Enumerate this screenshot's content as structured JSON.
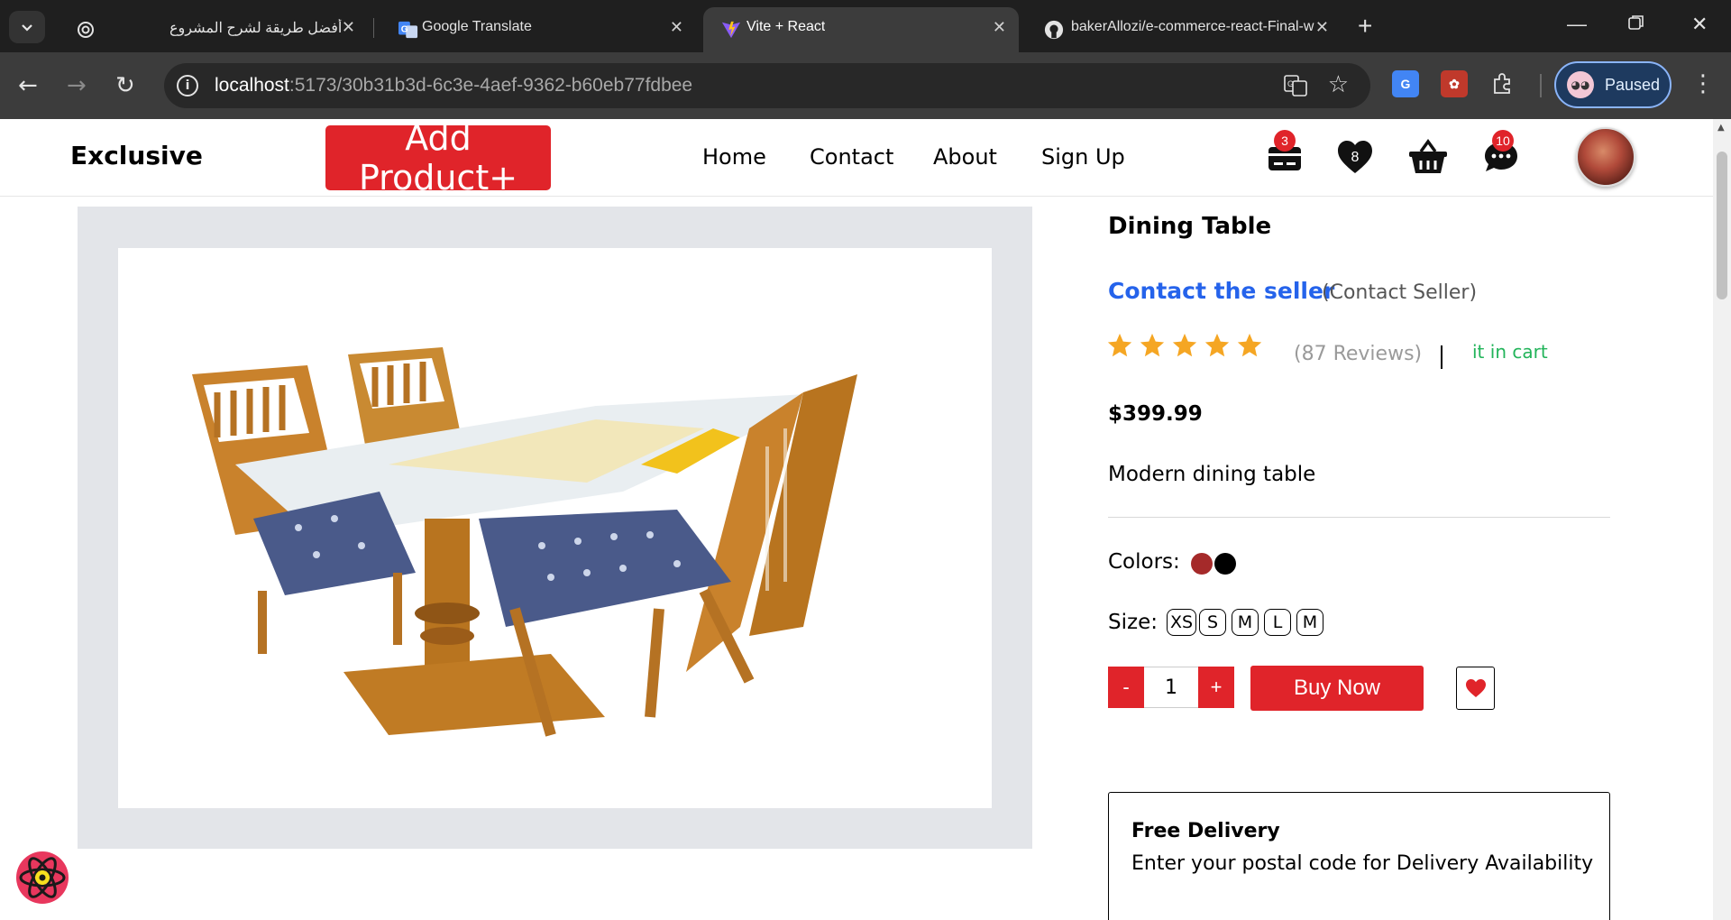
{
  "browser": {
    "tabs": [
      {
        "title": "أفضل طريقة لشرح المشروع",
        "icon": "chatgpt-icon",
        "active": false
      },
      {
        "title": "Google Translate",
        "icon": "google-translate-icon",
        "active": false
      },
      {
        "title": "Vite + React",
        "icon": "vite-icon",
        "active": true
      },
      {
        "title": "bakerAllozi/e-commerce-react-Final-w",
        "icon": "github-icon",
        "active": false
      }
    ],
    "url_host": "localhost",
    "url_path": ":5173/30b31b3d-6c3e-4aef-9362-b60eb77fdbee",
    "profile_label": "Paused"
  },
  "header": {
    "logo": "Exclusive",
    "add_product": "Add Product+",
    "nav": [
      "Home",
      "Contact",
      "About",
      "Sign Up"
    ],
    "badges": {
      "orders": "3",
      "wishlist": "8",
      "messages": "10"
    }
  },
  "product": {
    "name": "Dining Table",
    "contact_link": "Contact the seller",
    "contact_paren": "(Contact Seller)",
    "rating": 5,
    "reviews": "(87 Reviews)",
    "stock_status": "it in cart",
    "price": "$399.99",
    "description": "Modern dining table",
    "colors_label": "Colors:",
    "colors": [
      "#a52a2a",
      "#000000"
    ],
    "size_label": "Size:",
    "sizes": [
      "XS",
      "S",
      "M",
      "L",
      "M"
    ],
    "qty_minus": "-",
    "qty_value": "1",
    "qty_plus": "+",
    "buy_now": "Buy Now",
    "delivery_title": "Free Delivery",
    "delivery_text": "Enter your postal code for Delivery Availability"
  },
  "colors": {
    "accent": "#e0242a",
    "link": "#2563eb",
    "success": "#22b45a",
    "star": "#f5a623"
  }
}
